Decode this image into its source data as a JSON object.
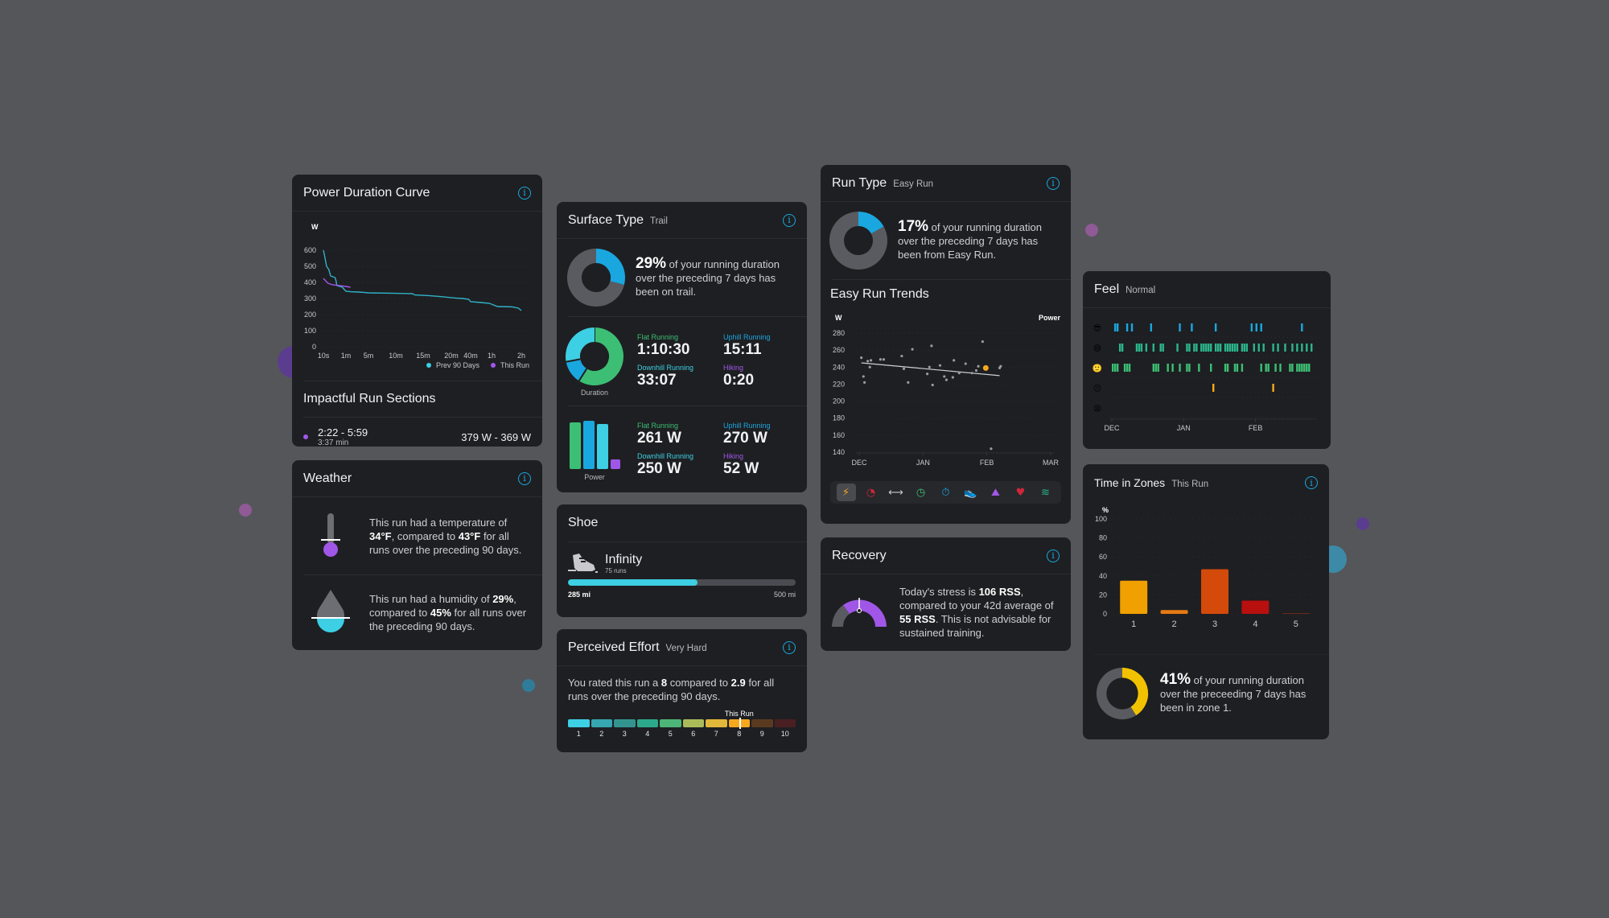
{
  "power_duration": {
    "title": "Power Duration Curve",
    "unit": "W",
    "legend_prev": "Prev 90 Days",
    "legend_this": "This Run",
    "chart_data": {
      "type": "line",
      "title": "Power Duration Curve",
      "ylabel": "W",
      "ylim": [
        0,
        600
      ],
      "yticks": [
        600,
        500,
        400,
        300,
        200,
        100,
        0
      ],
      "xticks": [
        "10s",
        "1m",
        "5m",
        "10m",
        "15m",
        "20m",
        "40m",
        "1h",
        "2h"
      ],
      "series": [
        {
          "name": "Prev 90 Days",
          "color": "#2fb3c9",
          "points": [
            [
              0,
              600
            ],
            [
              0.03,
              560
            ],
            [
              0.07,
              500
            ],
            [
              0.12,
              480
            ],
            [
              0.16,
              440
            ],
            [
              0.26,
              430
            ],
            [
              0.28,
              410
            ],
            [
              0.3,
              380
            ],
            [
              0.42,
              370
            ],
            [
              0.45,
              360
            ],
            [
              0.5,
              345
            ],
            [
              0.6,
              342
            ],
            [
              0.78,
              340
            ],
            [
              0.9,
              338
            ],
            [
              1.0,
              335
            ],
            [
              1.4,
              333
            ],
            [
              1.8,
              330
            ],
            [
              1.85,
              322
            ],
            [
              2.1,
              318
            ],
            [
              2.3,
              312
            ],
            [
              2.6,
              303
            ],
            [
              2.8,
              300
            ],
            [
              2.95,
              295
            ],
            [
              3.0,
              280
            ],
            [
              3.25,
              275
            ],
            [
              3.45,
              270
            ],
            [
              3.6,
              250
            ],
            [
              3.85,
              248
            ],
            [
              3.95,
              240
            ],
            [
              4.0,
              225
            ]
          ]
        },
        {
          "name": "This Run",
          "color": "#a057e8",
          "points": [
            [
              0,
              425
            ],
            [
              0.1,
              395
            ],
            [
              0.2,
              385
            ],
            [
              0.3,
              382
            ],
            [
              0.5,
              375
            ],
            [
              0.6,
              370
            ]
          ]
        }
      ]
    }
  },
  "impactful": {
    "title": "Impactful Run Sections",
    "range": "2:22 - 5:59",
    "duration": "3:37 min",
    "power": "379 W - 369 W"
  },
  "weather": {
    "title": "Weather",
    "temp_pre": "This run had a temperature of ",
    "temp_val": "34°F",
    "temp_mid": ", compared to ",
    "temp_avg": "43°F",
    "temp_post": " for all runs over the preceding 90 days.",
    "hum_pre": "This run had a humidity of ",
    "hum_val": "29%",
    "hum_mid": ", compared to ",
    "hum_avg": "45%",
    "hum_post": " for all runs over the preceding 90 days."
  },
  "surface": {
    "title": "Surface Type",
    "subtitle": "Trail",
    "percent": "29%",
    "percent_value": 0.29,
    "text": " of your running duration over the preceding 7 days has been on trail.",
    "duration_caption": "Duration",
    "power_caption": "Power",
    "duration_stats": [
      {
        "label": "Flat Running",
        "value": "1:10:30",
        "color": "#3cbf74"
      },
      {
        "label": "Uphill Running",
        "value": "15:11",
        "color": "#1aa7e0"
      },
      {
        "label": "Downhill Running",
        "value": "33:07",
        "color": "#3dcfe3"
      },
      {
        "label": "Hiking",
        "value": "0:20",
        "color": "#a057e8"
      }
    ],
    "duration_shares": [
      0.59,
      0.13,
      0.28,
      0.0
    ],
    "power_stats": [
      {
        "label": "Flat Running",
        "value": "261 W",
        "color": "#3cbf74"
      },
      {
        "label": "Uphill Running",
        "value": "270 W",
        "color": "#1aa7e0"
      },
      {
        "label": "Downhill Running",
        "value": "250 W",
        "color": "#3dcfe3"
      },
      {
        "label": "Hiking",
        "value": "52 W",
        "color": "#a057e8"
      }
    ],
    "power_values": [
      261,
      270,
      250,
      52
    ]
  },
  "shoe": {
    "title": "Shoe",
    "name": "Infinity",
    "runs": "75 runs",
    "current": "285 mi",
    "max": "500 mi",
    "progress": 0.57
  },
  "effort": {
    "title": "Perceived Effort",
    "subtitle": "Very Hard",
    "text_pre": "You rated this run a ",
    "rating": "8",
    "text_mid": " compared to ",
    "avg": "2.9",
    "text_post": " for all runs over the preceding 90 days.",
    "marker_label": "This Run",
    "marker_value": 8,
    "scale": [
      "1",
      "2",
      "3",
      "4",
      "5",
      "6",
      "7",
      "8",
      "9",
      "10"
    ],
    "colors": [
      "#3dcfe3",
      "#36a6b0",
      "#33948f",
      "#2ca88a",
      "#4cb578",
      "#abbb5a",
      "#e2b83a",
      "#f5a81e",
      "#5a3a1e",
      "#4a1f22"
    ]
  },
  "run_type": {
    "title": "Run Type",
    "subtitle": "Easy Run",
    "percent": "17%",
    "percent_value": 0.17,
    "text": " of your running duration over the preceding 7 days has been from Easy Run.",
    "trends_title": "Easy Run Trends",
    "metric_label": "Power",
    "chart_data": {
      "type": "scatter",
      "ylabel": "W",
      "ylim": [
        140,
        280
      ],
      "yticks": [
        280,
        260,
        240,
        220,
        200,
        180,
        160,
        140
      ],
      "xticks": [
        "DEC",
        "JAN",
        "FEB",
        "MAR"
      ],
      "xrange_days": [
        0,
        90
      ],
      "points": [
        [
          1,
          251
        ],
        [
          2,
          229
        ],
        [
          2.5,
          222
        ],
        [
          4,
          247
        ],
        [
          5,
          240
        ],
        [
          5.5,
          248
        ],
        [
          10,
          249
        ],
        [
          11.5,
          249
        ],
        [
          20,
          253
        ],
        [
          21,
          238
        ],
        [
          23,
          222
        ],
        [
          25,
          261
        ],
        [
          32,
          232
        ],
        [
          33,
          240
        ],
        [
          34,
          265
        ],
        [
          34.5,
          219
        ],
        [
          38,
          242
        ],
        [
          40,
          229
        ],
        [
          41,
          225
        ],
        [
          44,
          228
        ],
        [
          44.5,
          248
        ],
        [
          47,
          233
        ],
        [
          50,
          244
        ],
        [
          53,
          233
        ],
        [
          55,
          236
        ],
        [
          56,
          241
        ],
        [
          58,
          270
        ],
        [
          62,
          144
        ],
        [
          66,
          239
        ],
        [
          66.5,
          241
        ]
      ],
      "highlight": [
        59.5,
        239
      ],
      "trend": [
        [
          1,
          245
        ],
        [
          66,
          230
        ]
      ]
    },
    "icons": [
      "power-icon",
      "gauge-icon",
      "distance-icon",
      "clock-icon",
      "pace-icon",
      "shoe-icon",
      "hiking-icon",
      "heart-rate-icon",
      "cadence-icon"
    ]
  },
  "recovery": {
    "title": "Recovery",
    "text_pre": "Today's stress is ",
    "stress": "106 RSS",
    "text_mid": ", compared to your 42d average of ",
    "avg": "55 RSS",
    "text_post": ". This is not advisable for sustained training."
  },
  "feel": {
    "title": "Feel",
    "subtitle": "Normal",
    "xticks": [
      "DEC",
      "JAN",
      "FEB"
    ],
    "rows": [
      {
        "emoji": "😎",
        "color": "#1aa7e0",
        "days": [
          1,
          2,
          6,
          8,
          16,
          28,
          33,
          43,
          58,
          60,
          62,
          79
        ]
      },
      {
        "emoji": "😄",
        "color": "#2cb58c",
        "days": [
          3,
          4,
          10,
          11,
          12,
          14,
          17,
          20,
          21,
          27,
          31,
          32,
          34,
          35,
          37,
          38,
          39,
          40,
          41,
          43,
          44,
          45,
          47,
          48,
          49,
          50,
          51,
          52,
          54,
          55,
          56,
          59,
          61,
          63,
          67,
          69,
          72,
          75,
          77,
          79,
          81,
          83
        ]
      },
      {
        "emoji": "🙂",
        "color": "#3cbf74",
        "days": [
          0,
          1,
          2,
          5,
          6,
          7,
          17,
          18,
          19,
          23,
          25,
          28,
          31,
          32,
          36,
          41,
          47,
          48,
          51,
          52,
          54,
          62,
          64,
          65,
          68,
          70,
          74,
          75,
          77,
          78,
          79,
          80,
          81,
          82
        ]
      },
      {
        "emoji": "😐",
        "color": "#f5a81e",
        "days": [
          42,
          67
        ]
      },
      {
        "emoji": "😫",
        "color": "#e8a22e",
        "days": []
      }
    ]
  },
  "zones": {
    "title": "Time in Zones",
    "subtitle": "This Run",
    "percent": "41%",
    "percent_value": 0.41,
    "text": " of your running duration over the preceeding 7 days has been in zone 1.",
    "chart_data": {
      "type": "bar",
      "ylabel": "%",
      "ylim": [
        0,
        100
      ],
      "yticks": [
        100,
        80,
        60,
        40,
        20,
        0
      ],
      "categories": [
        "1",
        "2",
        "3",
        "4",
        "5"
      ],
      "values": [
        35,
        4,
        47,
        14,
        0.5
      ],
      "colors": [
        "#f0a000",
        "#e57a14",
        "#d34a0a",
        "#b80f0f",
        "#6b2a1a"
      ]
    }
  }
}
